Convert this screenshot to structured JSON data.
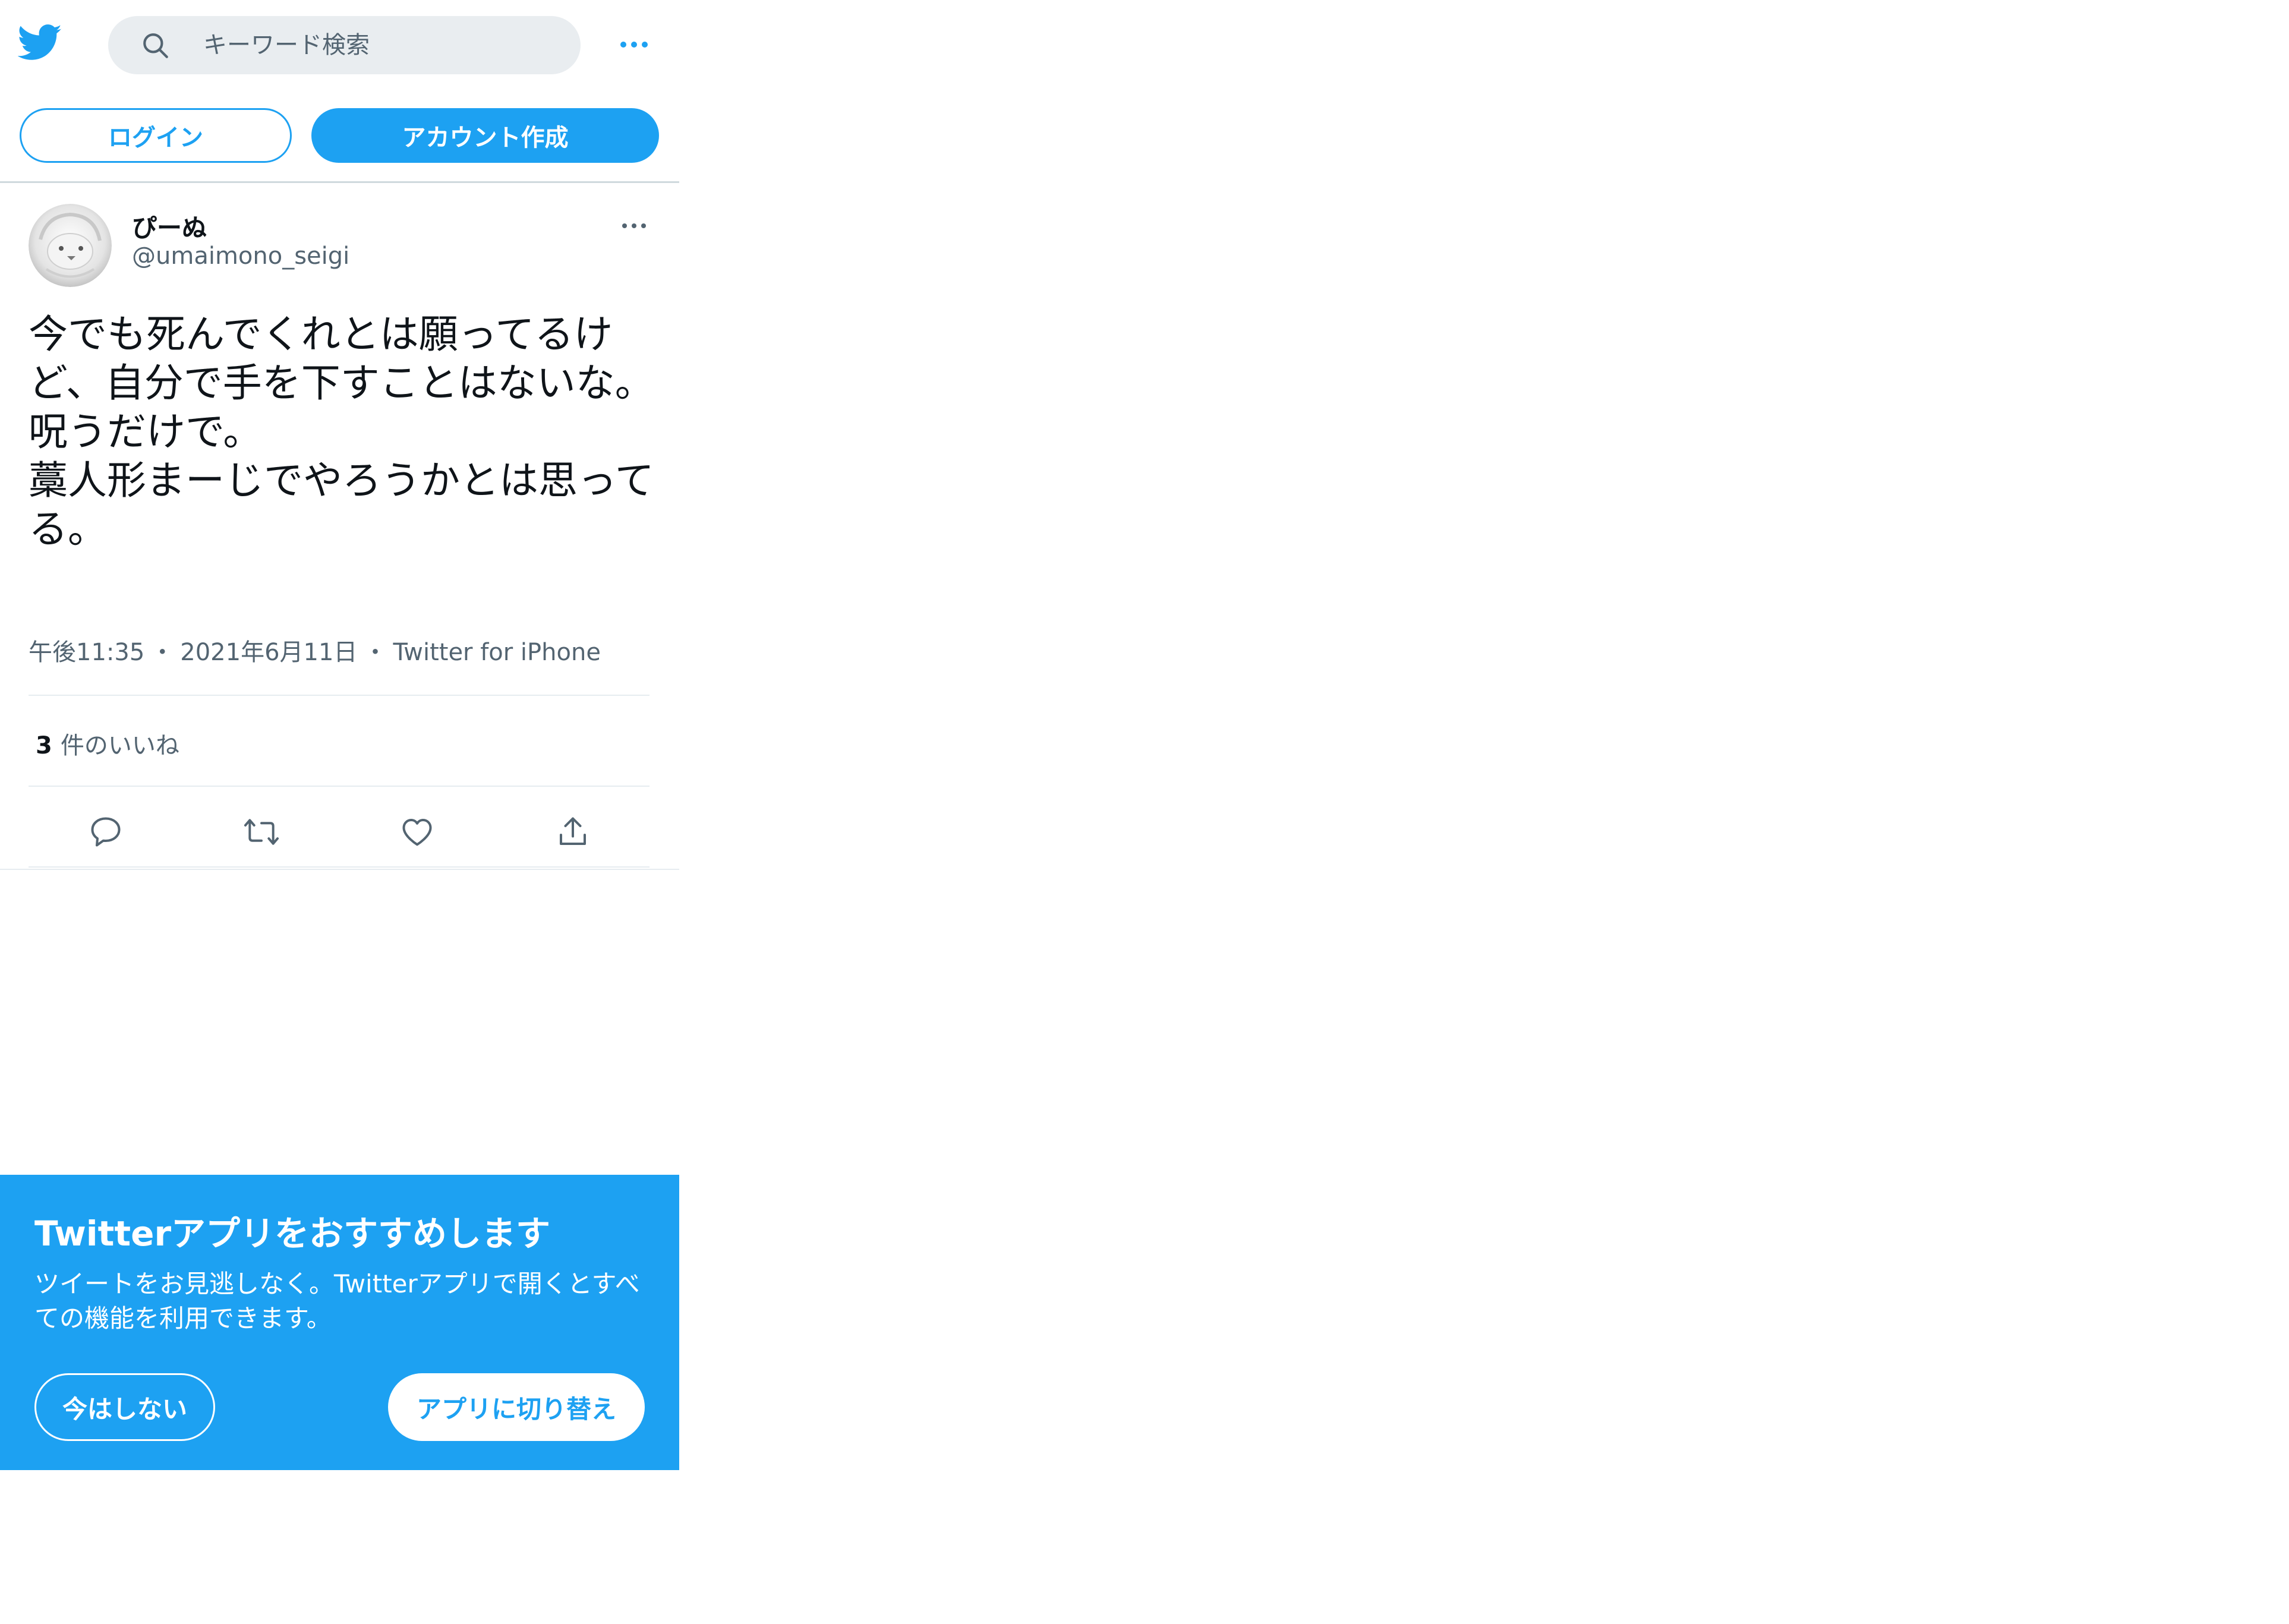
{
  "colors": {
    "accent": "#1da1f2",
    "text_primary": "#0f1419",
    "text_secondary": "#536471",
    "search_bg": "#e9edf0",
    "divider": "#e6ecf0"
  },
  "header": {
    "logo_icon": "twitter-bird-icon",
    "search": {
      "placeholder": "キーワード検索",
      "value": "",
      "icon": "search-icon"
    },
    "more_icon": "more-dots-icon"
  },
  "auth": {
    "login_label": "ログイン",
    "signup_label": "アカウント作成"
  },
  "tweet": {
    "display_name": "ぴーぬ",
    "handle": "@umaimono_seigi",
    "text": "今でも死んでくれとは願ってるけど、自分で手を下すことはないな。\n呪うだけで。\n藁人形まーじでやろうかとは思ってる。",
    "time": "午後11:35",
    "date": "2021年6月11日",
    "source": "Twitter for iPhone",
    "separator": "・",
    "likes_count": "3",
    "likes_label": "件のいいね",
    "actions": [
      "reply-icon",
      "retweet-icon",
      "like-icon",
      "share-icon"
    ]
  },
  "app_banner": {
    "title": "Twitterアプリをおすすめします",
    "body": "ツイートをお見逃しなく。Twitterアプリで開くとすべての機能を利用できます。",
    "not_now_label": "今はしない",
    "switch_label": "アプリに切り替え"
  }
}
